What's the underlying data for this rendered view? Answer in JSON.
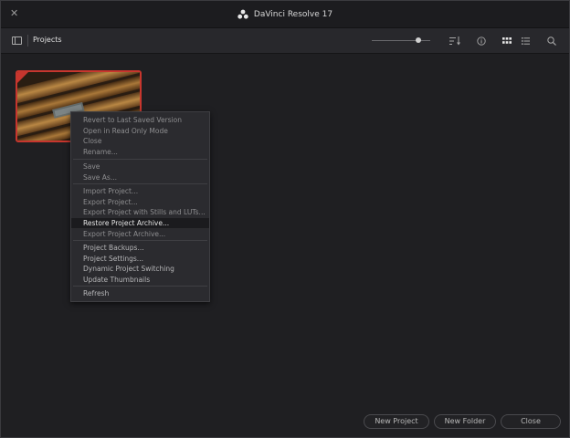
{
  "window": {
    "title": "DaVinci Resolve 17",
    "close_glyph": "✕"
  },
  "toolbar": {
    "section_label": "Projects",
    "thumbnail_size": 0.8
  },
  "menu": {
    "items": [
      {
        "label": "Revert to Last Saved Version",
        "state": "disabled"
      },
      {
        "label": "Open in Read Only Mode",
        "state": "disabled"
      },
      {
        "label": "Close",
        "state": "disabled"
      },
      {
        "label": "Rename...",
        "state": "disabled"
      },
      {
        "label": "Save",
        "state": "disabled"
      },
      {
        "label": "Save As...",
        "state": "disabled"
      },
      {
        "label": "Import Project...",
        "state": "disabled"
      },
      {
        "label": "Export Project...",
        "state": "disabled"
      },
      {
        "label": "Export Project with Stills and LUTs...",
        "state": "disabled"
      },
      {
        "label": "Restore Project Archive...",
        "state": "highlighted"
      },
      {
        "label": "Export Project Archive...",
        "state": "disabled"
      },
      {
        "label": "Project Backups...",
        "state": "enabled"
      },
      {
        "label": "Project Settings...",
        "state": "enabled"
      },
      {
        "label": "Dynamic Project Switching",
        "state": "enabled"
      },
      {
        "label": "Update Thumbnails",
        "state": "enabled"
      },
      {
        "label": "Refresh",
        "state": "enabled"
      }
    ]
  },
  "footer": {
    "new_project": "New Project",
    "new_folder": "New Folder",
    "close": "Close"
  },
  "colors": {
    "accent_red": "#c7362e",
    "background": "#1f1f22",
    "highlight": "#1b1b1e"
  }
}
